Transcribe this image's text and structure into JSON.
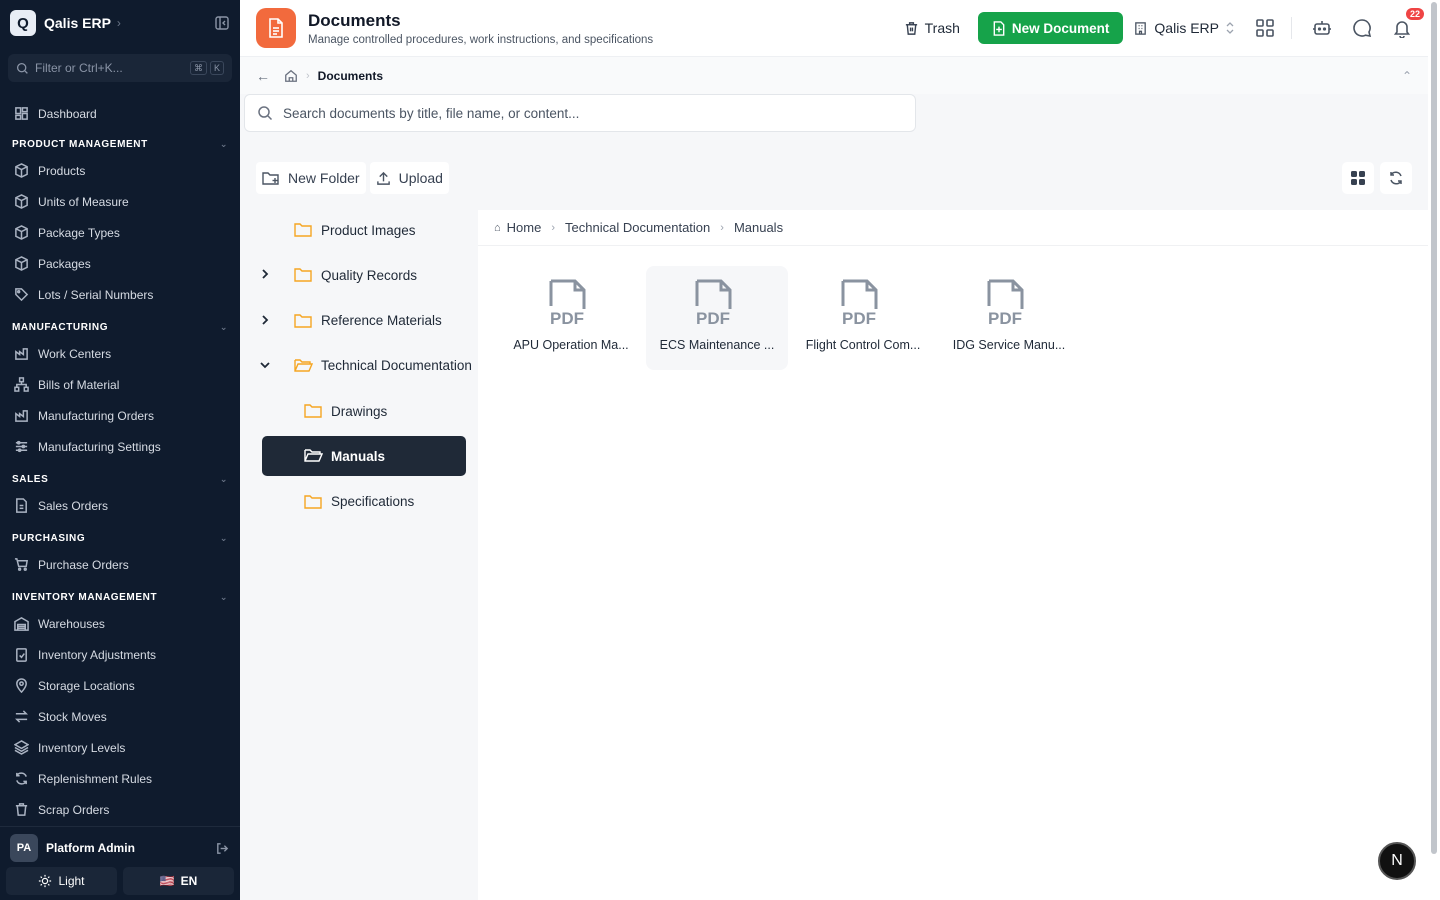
{
  "app": {
    "logo_letter": "Q",
    "name": "Qalis ERP"
  },
  "sidebar": {
    "filter_placeholder": "Filter or Ctrl+K...",
    "kbd": [
      "⌘",
      "K"
    ],
    "dashboard": "Dashboard",
    "sections": [
      {
        "title": "PRODUCT MANAGEMENT",
        "items": [
          "Products",
          "Units of Measure",
          "Package Types",
          "Packages",
          "Lots / Serial Numbers"
        ]
      },
      {
        "title": "MANUFACTURING",
        "items": [
          "Work Centers",
          "Bills of Material",
          "Manufacturing Orders",
          "Manufacturing Settings"
        ]
      },
      {
        "title": "SALES",
        "items": [
          "Sales Orders"
        ]
      },
      {
        "title": "PURCHASING",
        "items": [
          "Purchase Orders"
        ]
      },
      {
        "title": "INVENTORY MANAGEMENT",
        "items": [
          "Warehouses",
          "Inventory Adjustments",
          "Storage Locations",
          "Stock Moves",
          "Inventory Levels",
          "Replenishment Rules",
          "Scrap Orders"
        ]
      }
    ],
    "user": {
      "initials": "PA",
      "name": "Platform Admin"
    },
    "theme_label": "Light",
    "lang_label": "EN",
    "lang_flag": "🇺🇸"
  },
  "header": {
    "title": "Documents",
    "subtitle": "Manage controlled procedures, work instructions, and specifications",
    "trash_label": "Trash",
    "new_doc_label": "New Document",
    "org_label": "Qalis ERP",
    "notification_count": "22"
  },
  "breadcrumb": {
    "current": "Documents"
  },
  "search": {
    "placeholder": "Search documents by title, file name, or content..."
  },
  "toolbar": {
    "new_folder": "New Folder",
    "upload": "Upload"
  },
  "tree": {
    "items": [
      {
        "label": "Product Images",
        "caret": ""
      },
      {
        "label": "Quality Records",
        "caret": "›"
      },
      {
        "label": "Reference Materials",
        "caret": "›"
      },
      {
        "label": "Technical Documentation",
        "caret": "⌄"
      },
      {
        "label": "Drawings",
        "caret": ""
      },
      {
        "label": "Manuals",
        "caret": ""
      },
      {
        "label": "Specifications",
        "caret": ""
      }
    ]
  },
  "files_breadcrumb": [
    "Home",
    "Technical Documentation",
    "Manuals"
  ],
  "files": [
    {
      "name": "APU Operation Ma...",
      "type": "PDF"
    },
    {
      "name": "ECS Maintenance ...",
      "type": "PDF"
    },
    {
      "name": "Flight Control Com...",
      "type": "PDF"
    },
    {
      "name": "IDG Service Manu...",
      "type": "PDF"
    }
  ],
  "fab_letter": "N",
  "colors": {
    "sidebar_bg": "#0f1b2d",
    "accent_green": "#16a34a",
    "page_icon": "#f26a3d",
    "folder": "#f5a623",
    "badge": "#ef4444"
  }
}
